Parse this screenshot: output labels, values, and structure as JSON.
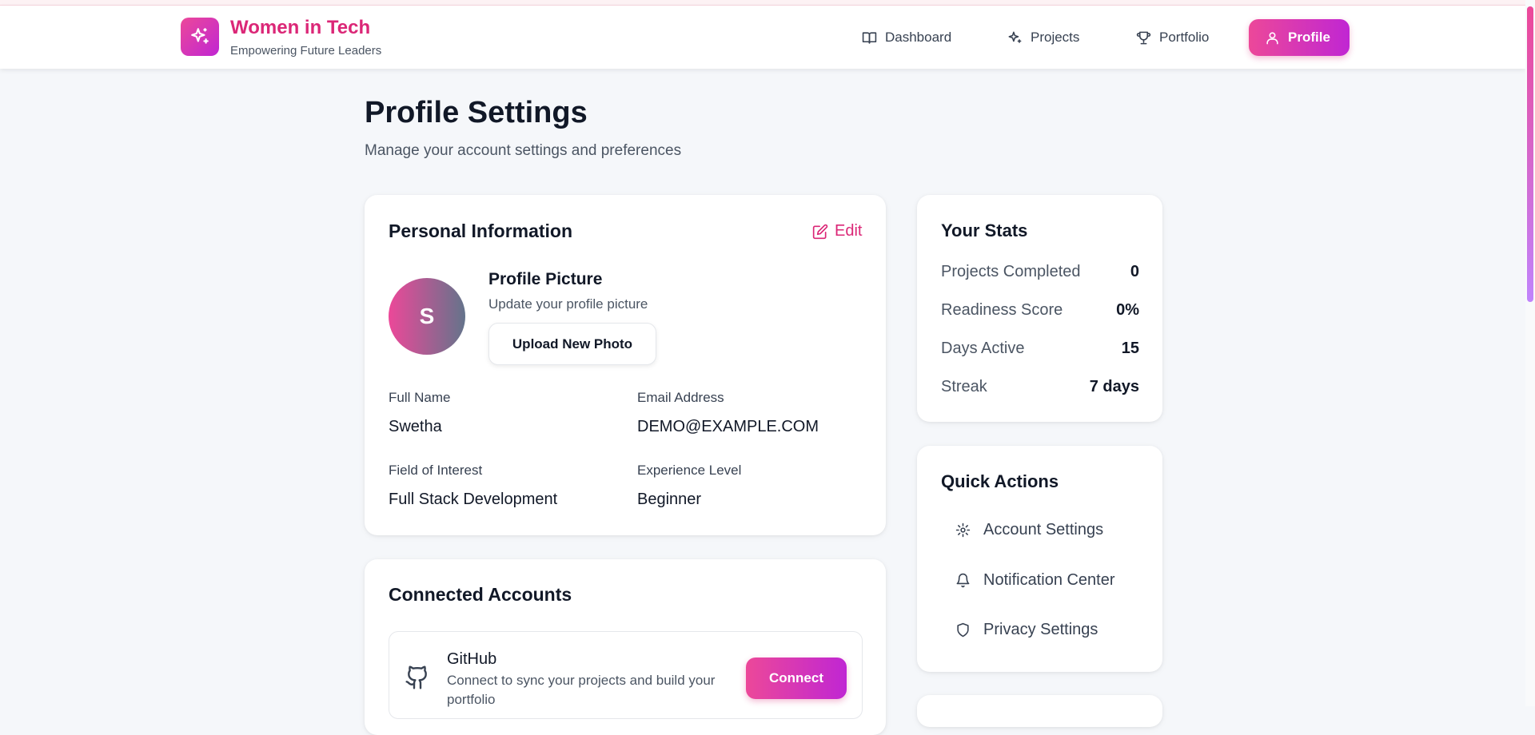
{
  "brand": {
    "title": "Women in Tech",
    "subtitle": "Empowering Future Leaders",
    "logo_icon": "sparkles-icon",
    "accent": "#db2777"
  },
  "nav": {
    "items": [
      {
        "label": "Dashboard",
        "icon": "book-icon"
      },
      {
        "label": "Projects",
        "icon": "sparkles-icon"
      },
      {
        "label": "Portfolio",
        "icon": "trophy-icon"
      },
      {
        "label": "Profile",
        "icon": "user-icon",
        "active": true
      }
    ]
  },
  "page": {
    "title": "Profile Settings",
    "subtitle": "Manage your account settings and preferences"
  },
  "personal_info": {
    "title": "Personal Information",
    "edit_label": "Edit",
    "avatar_initial": "S",
    "picture_title": "Profile Picture",
    "picture_subtitle": "Update your profile picture",
    "upload_label": "Upload New Photo",
    "fields": [
      {
        "label": "Full Name",
        "value": "Swetha"
      },
      {
        "label": "Email Address",
        "value": "DEMO@EXAMPLE.COM"
      },
      {
        "label": "Field of Interest",
        "value": "Full Stack Development"
      },
      {
        "label": "Experience Level",
        "value": "Beginner"
      }
    ]
  },
  "stats": {
    "title": "Your Stats",
    "items": [
      {
        "label": "Projects Completed",
        "value": "0"
      },
      {
        "label": "Readiness Score",
        "value": "0%"
      },
      {
        "label": "Days Active",
        "value": "15"
      },
      {
        "label": "Streak",
        "value": "7 days"
      }
    ]
  },
  "quick_actions": {
    "title": "Quick Actions",
    "items": [
      {
        "label": "Account Settings",
        "icon": "gear-icon"
      },
      {
        "label": "Notification Center",
        "icon": "bell-icon"
      },
      {
        "label": "Privacy Settings",
        "icon": "shield-icon"
      }
    ]
  },
  "connected_accounts": {
    "title": "Connected Accounts",
    "accounts": [
      {
        "name": "GitHub",
        "icon": "github-icon",
        "description": "Connect to sync your projects and build your portfolio",
        "action_label": "Connect"
      }
    ]
  }
}
